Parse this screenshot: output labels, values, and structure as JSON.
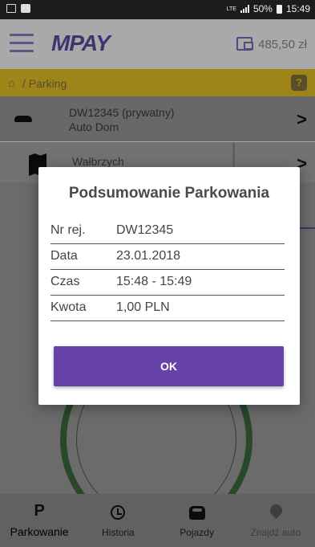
{
  "statusbar": {
    "network": "LTE",
    "battery": "50%",
    "time": "15:49"
  },
  "appbar": {
    "logo": "MPAY",
    "balance": "485,50 zł"
  },
  "breadcrumb": {
    "path": "/ Parking",
    "help": "?"
  },
  "vehicle": {
    "line1": "DW12345 (prywatny)",
    "line2": "Auto Dom",
    "chevron": ">"
  },
  "city": {
    "name": "Wałbrzych",
    "chevron": ">"
  },
  "dialog": {
    "title": "Podsumowanie Parkowania",
    "rows": [
      {
        "label": "Nr rej.",
        "value": "DW12345"
      },
      {
        "label": "Data",
        "value": "23.01.2018"
      },
      {
        "label": "Czas",
        "value": "15:48 - 15:49"
      },
      {
        "label": "Kwota",
        "value": "1,00 PLN"
      }
    ],
    "ok_label": "OK"
  },
  "bottomnav": {
    "items": [
      {
        "label": "Parkowanie",
        "icon": "P"
      },
      {
        "label": "Historia",
        "icon": "history-icon"
      },
      {
        "label": "Pojazdy",
        "icon": "car-icon"
      },
      {
        "label": "Znajdź auto",
        "icon": "pin-icon"
      }
    ]
  },
  "colors": {
    "accent": "#6743a8",
    "breadcrumb": "#e8b900",
    "logo": "#5b4fa6"
  }
}
